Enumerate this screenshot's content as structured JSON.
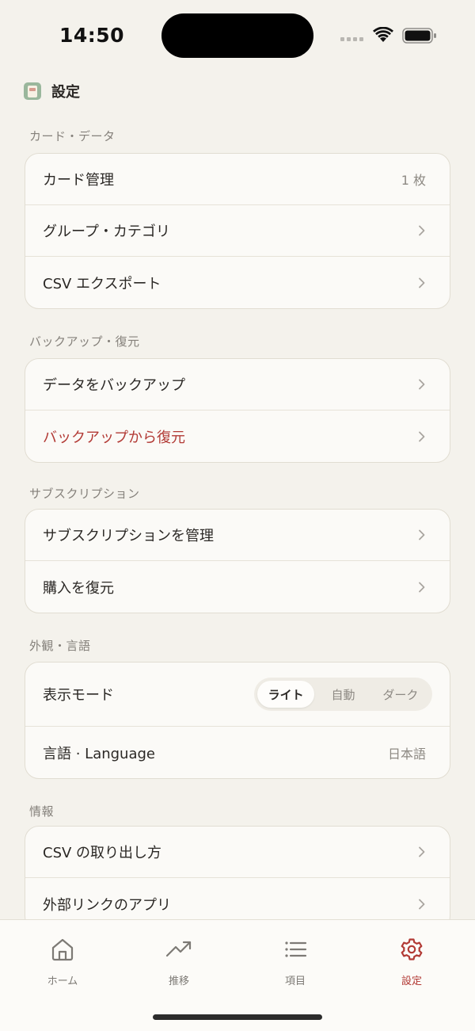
{
  "status_bar": {
    "time": "14:50"
  },
  "header": {
    "title": "設定"
  },
  "sections": {
    "card_data": {
      "label": "カード・データ",
      "items": [
        {
          "label": "カード管理",
          "value": "1 枚"
        },
        {
          "label": "グループ・カテゴリ"
        },
        {
          "label": "CSV エクスポート"
        }
      ]
    },
    "backup": {
      "label": "バックアップ・復元",
      "items": [
        {
          "label": "データをバックアップ"
        },
        {
          "label": "バックアップから復元"
        }
      ]
    },
    "subscription": {
      "label": "サブスクリプション",
      "items": [
        {
          "label": "サブスクリプションを管理"
        },
        {
          "label": "購入を復元"
        }
      ]
    },
    "appearance": {
      "label": "外観・言語",
      "display_mode": {
        "label": "表示モード",
        "options": [
          "ライト",
          "自動",
          "ダーク"
        ],
        "selected": "ライト"
      },
      "language": {
        "label": "言語 · Language",
        "value": "日本語"
      }
    },
    "info": {
      "label": "情報",
      "items": [
        {
          "label": "CSV の取り出し方"
        },
        {
          "label": "外部リンクのアプリ"
        }
      ]
    }
  },
  "tab_bar": {
    "tabs": [
      {
        "label": "ホーム",
        "icon": "home-icon"
      },
      {
        "label": "推移",
        "icon": "trend-icon"
      },
      {
        "label": "項目",
        "icon": "list-icon"
      },
      {
        "label": "設定",
        "icon": "gear-icon",
        "active": true
      }
    ]
  },
  "colors": {
    "accent": "#b23a35",
    "background": "#f4f2ec",
    "card": "#fbfaf7"
  }
}
